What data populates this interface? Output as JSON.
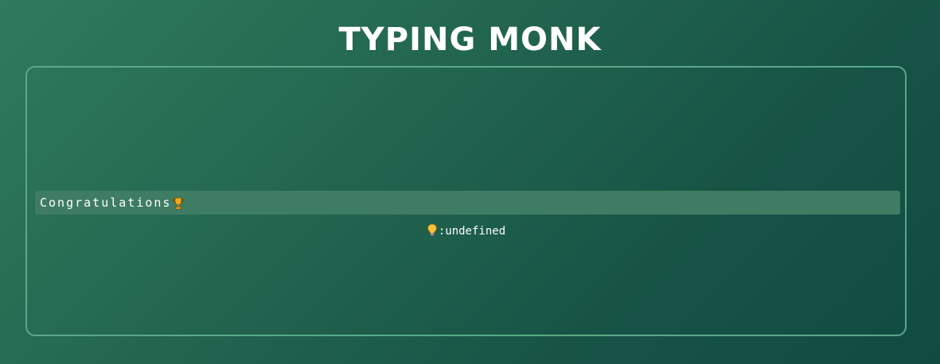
{
  "app": {
    "title": "TYPING MONK"
  },
  "typing_area": {
    "message": "Congratulations",
    "message_icon": "trophy-icon",
    "hint_icon": "lightbulb-icon",
    "hint_text": ":undefined"
  },
  "colors": {
    "accent_border": "#5aa889",
    "line_highlight": "#3e7c63",
    "trophy": "#f0a81c",
    "bulb": "#f4c23c"
  }
}
